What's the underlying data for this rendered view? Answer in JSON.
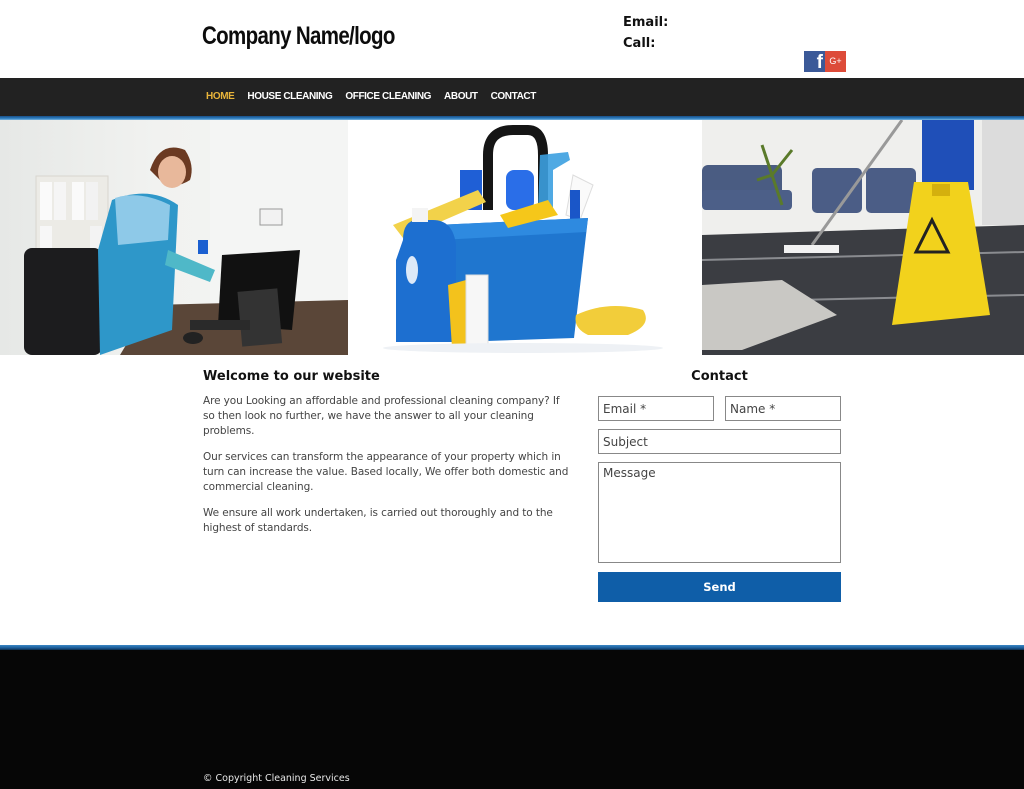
{
  "header": {
    "logo_text": "Company Name/logo",
    "email_label": "Email:",
    "call_label": "Call:",
    "social": [
      {
        "name": "facebook",
        "glyph": "f",
        "color": "#3b5998"
      },
      {
        "name": "google-plus",
        "glyph": "G+",
        "color": "#dd4b39"
      }
    ]
  },
  "nav": {
    "items": [
      {
        "label": "HOME",
        "active": true
      },
      {
        "label": "HOUSE CLEANING",
        "active": false
      },
      {
        "label": "OFFICE CLEANING",
        "active": false
      },
      {
        "label": "ABOUT",
        "active": false
      },
      {
        "label": "CONTACT",
        "active": false
      }
    ],
    "active_color": "#e8b43a"
  },
  "hero": {
    "images": [
      {
        "subject": "woman cleaning office computer"
      },
      {
        "subject": "blue bucket with cleaning supplies"
      },
      {
        "subject": "mopping floor with wet floor sign"
      }
    ]
  },
  "welcome": {
    "title": "Welcome to our website",
    "paragraphs": [
      "Are you Looking an affordable and professional cleaning company? If so then look no further, we have the answer to all your cleaning problems.",
      "Our services can transform the appearance of your property which in turn can increase the value. Based locally, We offer both domestic and commercial cleaning.",
      "We ensure all work undertaken, is carried out thoroughly and to the highest of standards."
    ]
  },
  "contact_form": {
    "title": "Contact",
    "email_placeholder": "Email *",
    "name_placeholder": "Name *",
    "subject_placeholder": "Subject",
    "message_placeholder": "Message",
    "send_label": "Send",
    "button_color": "#0f5ea8"
  },
  "footer": {
    "copyright": "© Copyright Cleaning Services"
  }
}
